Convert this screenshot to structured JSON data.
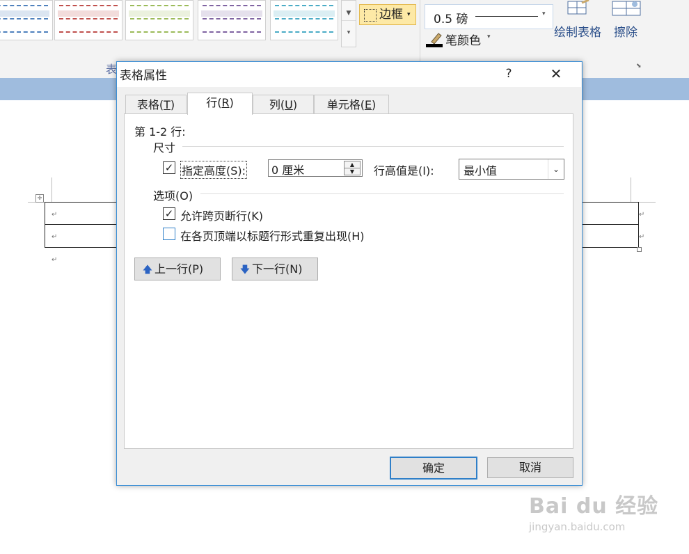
{
  "ribbon": {
    "group_label_left": "表",
    "border_button_label": "边框",
    "pen_weight_value": "0.5 磅",
    "pen_color_label": "笔颜色",
    "draw_table_label": "绘制表格",
    "eraser_label": "擦除",
    "style_colors": [
      "#4f81bd",
      "#c0504d",
      "#9bbb59",
      "#8064a2",
      "#4bacc6"
    ]
  },
  "dialog": {
    "title": "表格属性",
    "help_label": "?",
    "close_label": "✕",
    "tabs": [
      "表格(T)",
      "行(R)",
      "列(U)",
      "单元格(E)"
    ],
    "tab_mnemonics": [
      "T",
      "R",
      "U",
      "E"
    ],
    "active_tab": "行(R)",
    "rows_label": "第 1-2 行:",
    "size_section": "尺寸",
    "specify_height_label": "指定高度(S):",
    "specify_height_checked": true,
    "height_value": "0 厘米",
    "row_height_is_label": "行高值是(I):",
    "row_height_mode": "最小值",
    "options_section": "选项(O)",
    "allow_break_label": "允许跨页断行(K)",
    "allow_break_checked": true,
    "repeat_header_label": "在各页顶端以标题行形式重复出现(H)",
    "repeat_header_checked": false,
    "prev_row_label": "上一行(P)",
    "next_row_label": "下一行(N)",
    "ok_label": "确定",
    "cancel_label": "取消"
  },
  "document": {
    "paragraph_mark": "↵"
  },
  "watermark": {
    "brand": "Bai du 经验",
    "url": "jingyan.baidu.com"
  }
}
